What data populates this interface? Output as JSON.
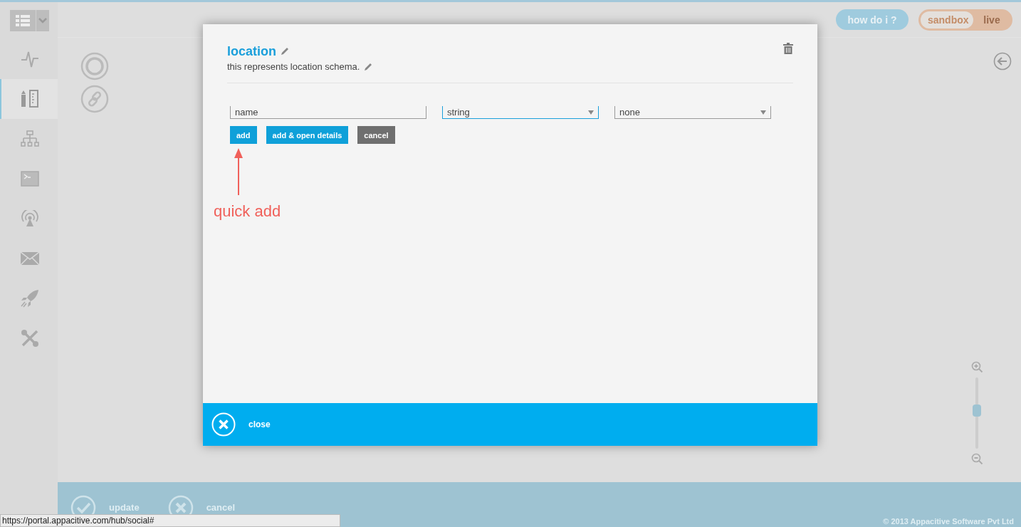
{
  "toolbar": {
    "help_button": "how do i ?",
    "environments": [
      {
        "label": "sandbox",
        "selected": true
      },
      {
        "label": "live",
        "selected": false
      }
    ]
  },
  "sidebar": {
    "items": [
      {
        "kind": "pulse",
        "selected": false
      },
      {
        "kind": "schema",
        "selected": true
      },
      {
        "kind": "hierarchy",
        "selected": false
      },
      {
        "kind": "terminal",
        "selected": false
      },
      {
        "kind": "broadcast",
        "selected": false
      },
      {
        "kind": "mail",
        "selected": false
      },
      {
        "kind": "rocket",
        "selected": false
      },
      {
        "kind": "tools",
        "selected": false
      }
    ]
  },
  "modal": {
    "title": "location",
    "description": "this represents location schema.",
    "fields": [
      {
        "kind": "input",
        "value": "name",
        "focused": false
      },
      {
        "kind": "select",
        "value": "string",
        "focused": true
      },
      {
        "kind": "select",
        "value": "none",
        "focused": false
      }
    ],
    "buttons": [
      {
        "label": "add",
        "kind": "primary"
      },
      {
        "label": "add & open details",
        "kind": "primary"
      },
      {
        "label": "cancel",
        "kind": "secondary"
      }
    ],
    "annotation": "quick add",
    "close_label": "close"
  },
  "zoom": {
    "level": 0.54
  },
  "footer": {
    "actions": [
      {
        "label": "update",
        "kind": "check"
      },
      {
        "label": "cancel",
        "kind": "cross"
      }
    ],
    "copyright": "© 2013 Appacitive Software Pvt Ltd"
  },
  "status_url": "https://portal.appacitive.com/hub/social#"
}
